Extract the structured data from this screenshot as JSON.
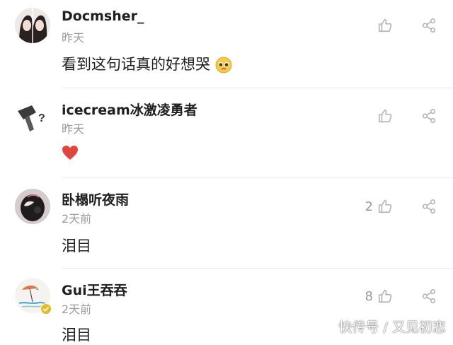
{
  "comments": [
    {
      "username": "Docmsher_",
      "time": "昨天",
      "text": "看到这句话真的好想哭",
      "emoji": "pleading-face",
      "likes": ""
    },
    {
      "username": "icecream冰激凌勇者",
      "time": "昨天",
      "text": "",
      "emoji": "red-heart",
      "likes": ""
    },
    {
      "username": "卧榻听夜雨",
      "time": "2天前",
      "text": "泪目",
      "emoji": "",
      "likes": "2"
    },
    {
      "username": "Gui王吞吞",
      "time": "2天前",
      "text": "泪目",
      "emoji": "",
      "likes": "8"
    }
  ],
  "watermark": "快传号 / 又见初恋",
  "colors": {
    "icon": "#b5b5b5",
    "time": "#9a9a9a",
    "heart": "#e0463c",
    "verified": "#e8b923"
  }
}
